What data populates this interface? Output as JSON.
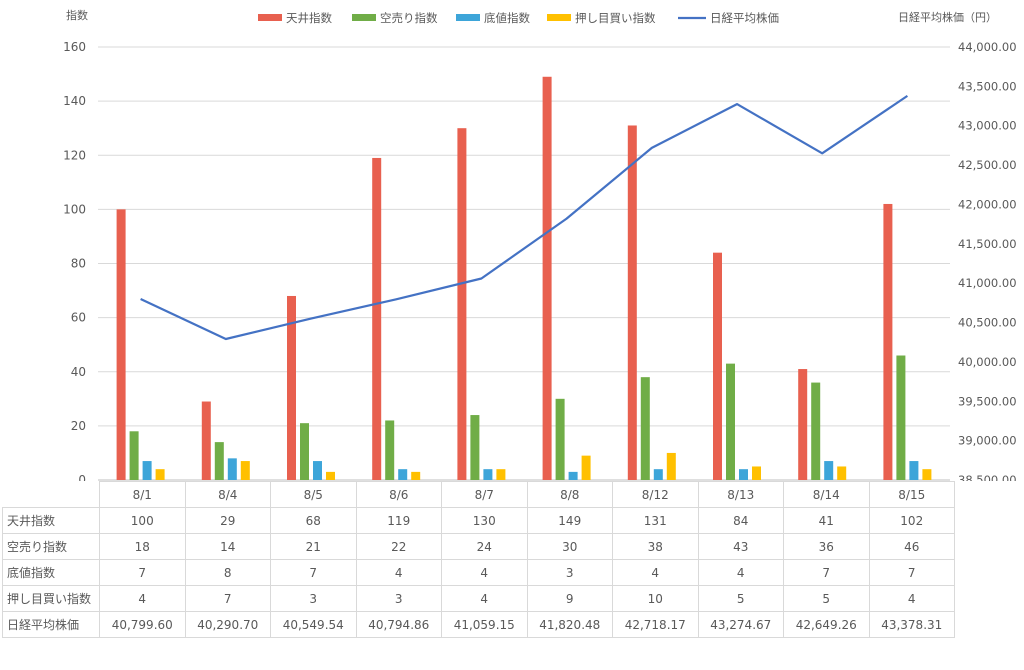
{
  "chart_data": {
    "type": "bar",
    "categories": [
      "8/1",
      "8/4",
      "8/5",
      "8/6",
      "8/7",
      "8/8",
      "8/12",
      "8/13",
      "8/14",
      "8/15"
    ],
    "series": [
      {
        "name": "天井指数",
        "kind": "bar",
        "axis": "left",
        "color": "#E8604F",
        "values": [
          100,
          29,
          68,
          119,
          130,
          149,
          131,
          84,
          41,
          102
        ]
      },
      {
        "name": "空売り指数",
        "kind": "bar",
        "axis": "left",
        "color": "#70AD47",
        "values": [
          18,
          14,
          21,
          22,
          24,
          30,
          38,
          43,
          36,
          46
        ]
      },
      {
        "name": "底値指数",
        "kind": "bar",
        "axis": "left",
        "color": "#3DA5D9",
        "values": [
          7,
          8,
          7,
          4,
          4,
          3,
          4,
          4,
          7,
          7
        ]
      },
      {
        "name": "押し目買い指数",
        "kind": "bar",
        "axis": "left",
        "color": "#FFC000",
        "values": [
          4,
          7,
          3,
          3,
          4,
          9,
          10,
          5,
          5,
          4
        ]
      },
      {
        "name": "日経平均株価",
        "kind": "line",
        "axis": "right",
        "color": "#4472C4",
        "values": [
          40799.6,
          40290.7,
          40549.54,
          40794.86,
          41059.15,
          41820.48,
          42718.17,
          43274.67,
          42649.26,
          43378.31
        ]
      }
    ],
    "ylabel": "指数",
    "ylabel_right": "日経平均株価（円）",
    "ylim": [
      0,
      160
    ],
    "y_ticks": [
      "0",
      "20",
      "40",
      "60",
      "80",
      "100",
      "120",
      "140",
      "160"
    ],
    "ylim_right": [
      38500,
      44000
    ],
    "y2_ticks": [
      "38,500.00",
      "39,000.00",
      "39,500.00",
      "40,000.00",
      "40,500.00",
      "41,000.00",
      "41,500.00",
      "42,000.00",
      "42,500.00",
      "43,000.00",
      "43,500.00",
      "44,000.00"
    ],
    "grid": true,
    "legend_position": "top"
  },
  "table": {
    "rows": [
      {
        "label": "天井指数",
        "cells": [
          "100",
          "29",
          "68",
          "119",
          "130",
          "149",
          "131",
          "84",
          "41",
          "102"
        ]
      },
      {
        "label": "空売り指数",
        "cells": [
          "18",
          "14",
          "21",
          "22",
          "24",
          "30",
          "38",
          "43",
          "36",
          "46"
        ]
      },
      {
        "label": "底値指数",
        "cells": [
          "7",
          "8",
          "7",
          "4",
          "4",
          "3",
          "4",
          "4",
          "7",
          "7"
        ]
      },
      {
        "label": "押し目買い指数",
        "cells": [
          "4",
          "7",
          "3",
          "3",
          "4",
          "9",
          "10",
          "5",
          "5",
          "4"
        ]
      },
      {
        "label": "日経平均株価",
        "cells": [
          "40,799.60",
          "40,290.70",
          "40,549.54",
          "40,794.86",
          "41,059.15",
          "41,820.48",
          "42,718.17",
          "43,274.67",
          "42,649.26",
          "43,378.31"
        ]
      }
    ]
  }
}
